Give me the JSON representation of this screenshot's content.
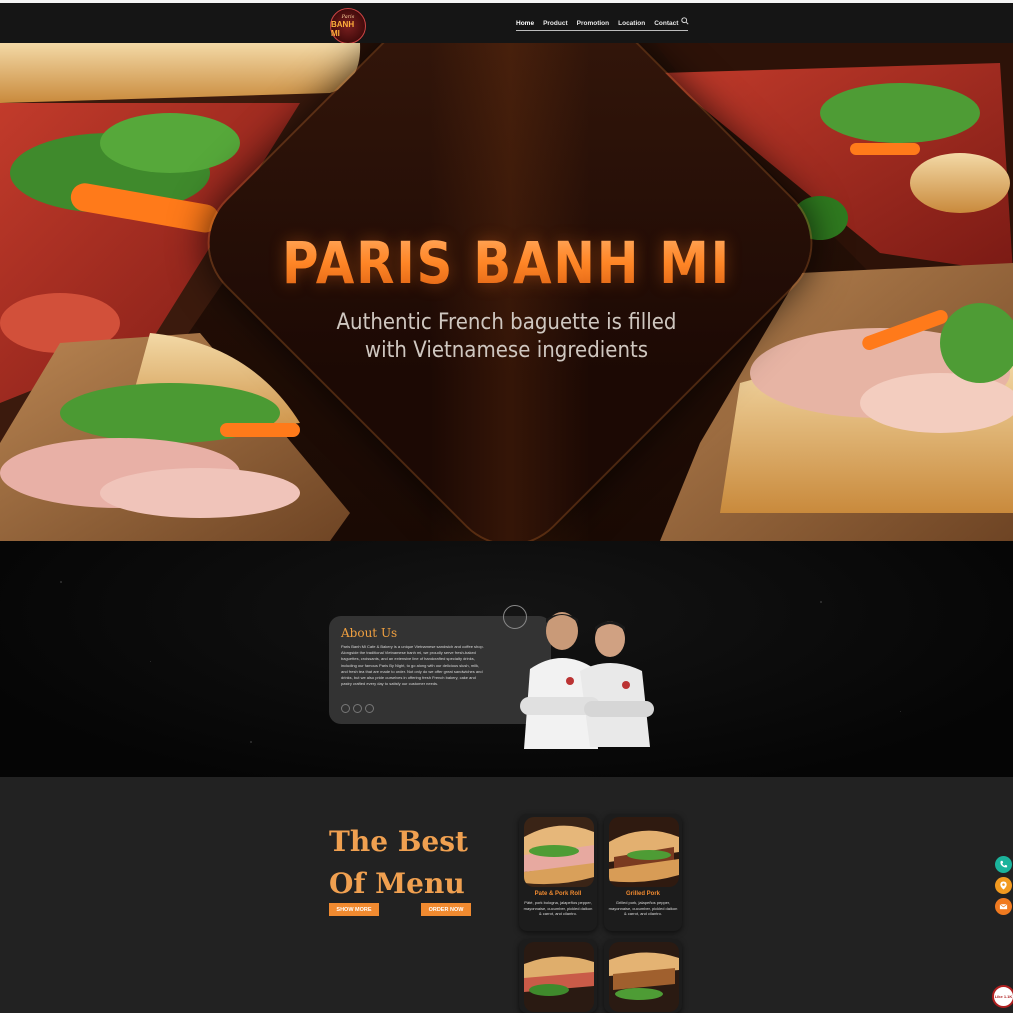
{
  "brand": {
    "logo_top": "Paris",
    "logo_bottom": "BANH MI"
  },
  "nav": {
    "items": [
      "Home",
      "Product",
      "Promotion",
      "Location",
      "Contact"
    ],
    "active": "Home"
  },
  "hero": {
    "title": "PARIS BANH MI",
    "subtitle_line1": "Authentic French baguette is filled",
    "subtitle_line2": "with Vietnamese ingredients"
  },
  "about": {
    "title": "About Us",
    "text": "Paris Banh Mi Cafe & Bakery is a unique Vietnamese sandwich and coffee shop. Alongside the traditional Vietnamese banh mi, we proudly serve fresh-baked baguettes, croissants, and an extensive line of handcrafted specialty drinks, including our famous Paris By Night, to go along with our delicious slush, milk, and fresh tea that are made to order. Not only do we offer great sandwiches and drinks, but we also pride ourselves in offering fresh French bakery, cake and pastry crafted every day to satisfy our customer needs."
  },
  "menu": {
    "title_line1": "The Best",
    "title_line2": "Of Menu",
    "show_more": "SHOW MORE",
    "order_now": "ORDER NOW",
    "items": [
      {
        "name": "Pate & Pork Roll",
        "desc": "Pâté, pork bologna, jalapeños pepper, mayonnaise, cucumber, pickled daikon & carrot, and cilantro."
      },
      {
        "name": "Grilled Pork",
        "desc": "Grilled pork, jalapeños pepper, mayonnaise, cucumber, pickled daikon & carrot, and cilantro."
      }
    ]
  },
  "floating": {
    "like_label": "Like 1.1K"
  },
  "colors": {
    "accent": "#f08a30",
    "nav_bg": "#151515",
    "section_bg": "#222222"
  }
}
